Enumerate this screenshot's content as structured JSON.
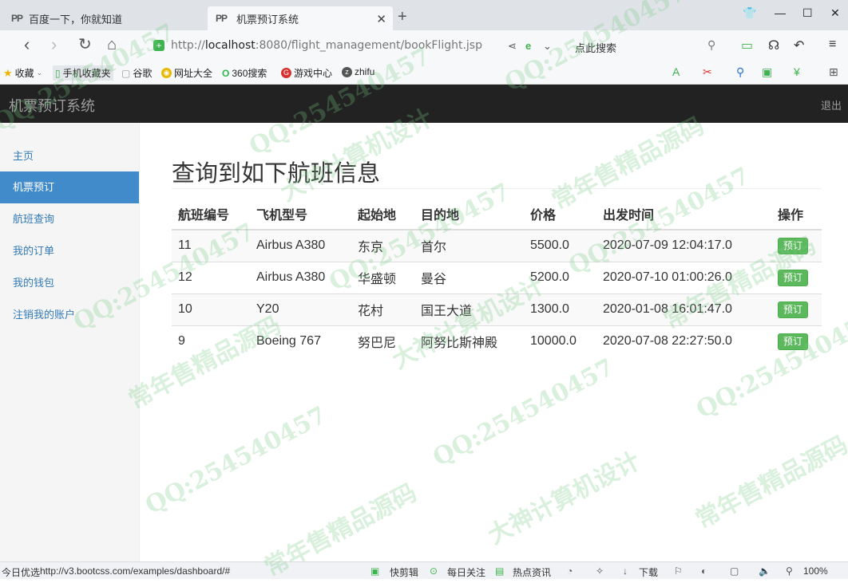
{
  "browser": {
    "tabs": [
      {
        "favicon": "PP",
        "title": "百度一下，你就知道"
      },
      {
        "favicon": "PP",
        "title": "机票预订系统"
      }
    ],
    "url": {
      "prefix": "http://",
      "host": "localhost",
      "path": ":8080/flight_management/bookFlight.jsp"
    },
    "search_placeholder": "点此搜索",
    "bookmarks": [
      {
        "label": "收藏",
        "icon": "star-icon",
        "color": "#f0b400"
      },
      {
        "label": "手机收藏夹",
        "icon": "phone-icon",
        "color": "#3fb34f"
      },
      {
        "label": "谷歌",
        "icon": "page-icon",
        "color": "#999999"
      },
      {
        "label": "网址大全",
        "icon": "globe-icon",
        "color": "#e6b800"
      },
      {
        "label": "360搜索",
        "icon": "search-360-icon",
        "color": "#2db84c"
      },
      {
        "label": "游戏中心",
        "icon": "game-icon",
        "color": "#d8302f"
      },
      {
        "label": "zhifu",
        "icon": "zhifu-icon",
        "color": "#555555"
      }
    ],
    "zoom": "100%",
    "status_left": "今日优选",
    "status_url": "http://v3.bootcss.com/examples/dashboard/#",
    "status_items": [
      "快剪辑",
      "每日关注",
      "热点资讯",
      "下载"
    ]
  },
  "app": {
    "brand": "机票预订系统",
    "logout_label": "退出",
    "sidebar": [
      {
        "label": "主页",
        "active": false
      },
      {
        "label": "机票预订",
        "active": true
      },
      {
        "label": "航班查询",
        "active": false
      },
      {
        "label": "我的订单",
        "active": false
      },
      {
        "label": "我的钱包",
        "active": false
      },
      {
        "label": "注销我的账户",
        "active": false
      }
    ],
    "page_title": "查询到如下航班信息",
    "table": {
      "headers": [
        "航班编号",
        "飞机型号",
        "起始地",
        "目的地",
        "价格",
        "出发时间",
        "操作"
      ],
      "rows": [
        {
          "id": "11",
          "model": "Airbus A380",
          "from": "东京",
          "to": "首尔",
          "price": "5500.0",
          "time": "2020-07-09 12:04:17.0",
          "action": "预订"
        },
        {
          "id": "12",
          "model": "Airbus A380",
          "from": "华盛顿",
          "to": "曼谷",
          "price": "5200.0",
          "time": "2020-07-10 01:00:26.0",
          "action": "预订"
        },
        {
          "id": "10",
          "model": "Y20",
          "from": "花村",
          "to": "国王大道",
          "price": "1300.0",
          "time": "2020-01-08 16:01:47.0",
          "action": "预订"
        },
        {
          "id": "9",
          "model": "Boeing 767",
          "from": "努巴尼",
          "to": "阿努比斯神殿",
          "price": "10000.0",
          "time": "2020-07-08 22:27:50.0",
          "action": "预订"
        }
      ]
    }
  },
  "watermarks": {
    "qq": "QQ:254540457",
    "shop": "常年售精品源码",
    "design": "大神计算机设计"
  },
  "colors": {
    "navbar": "#222222",
    "sidebar_active": "#428bca",
    "book_button": "#5cb85c",
    "link": "#337ab7"
  }
}
